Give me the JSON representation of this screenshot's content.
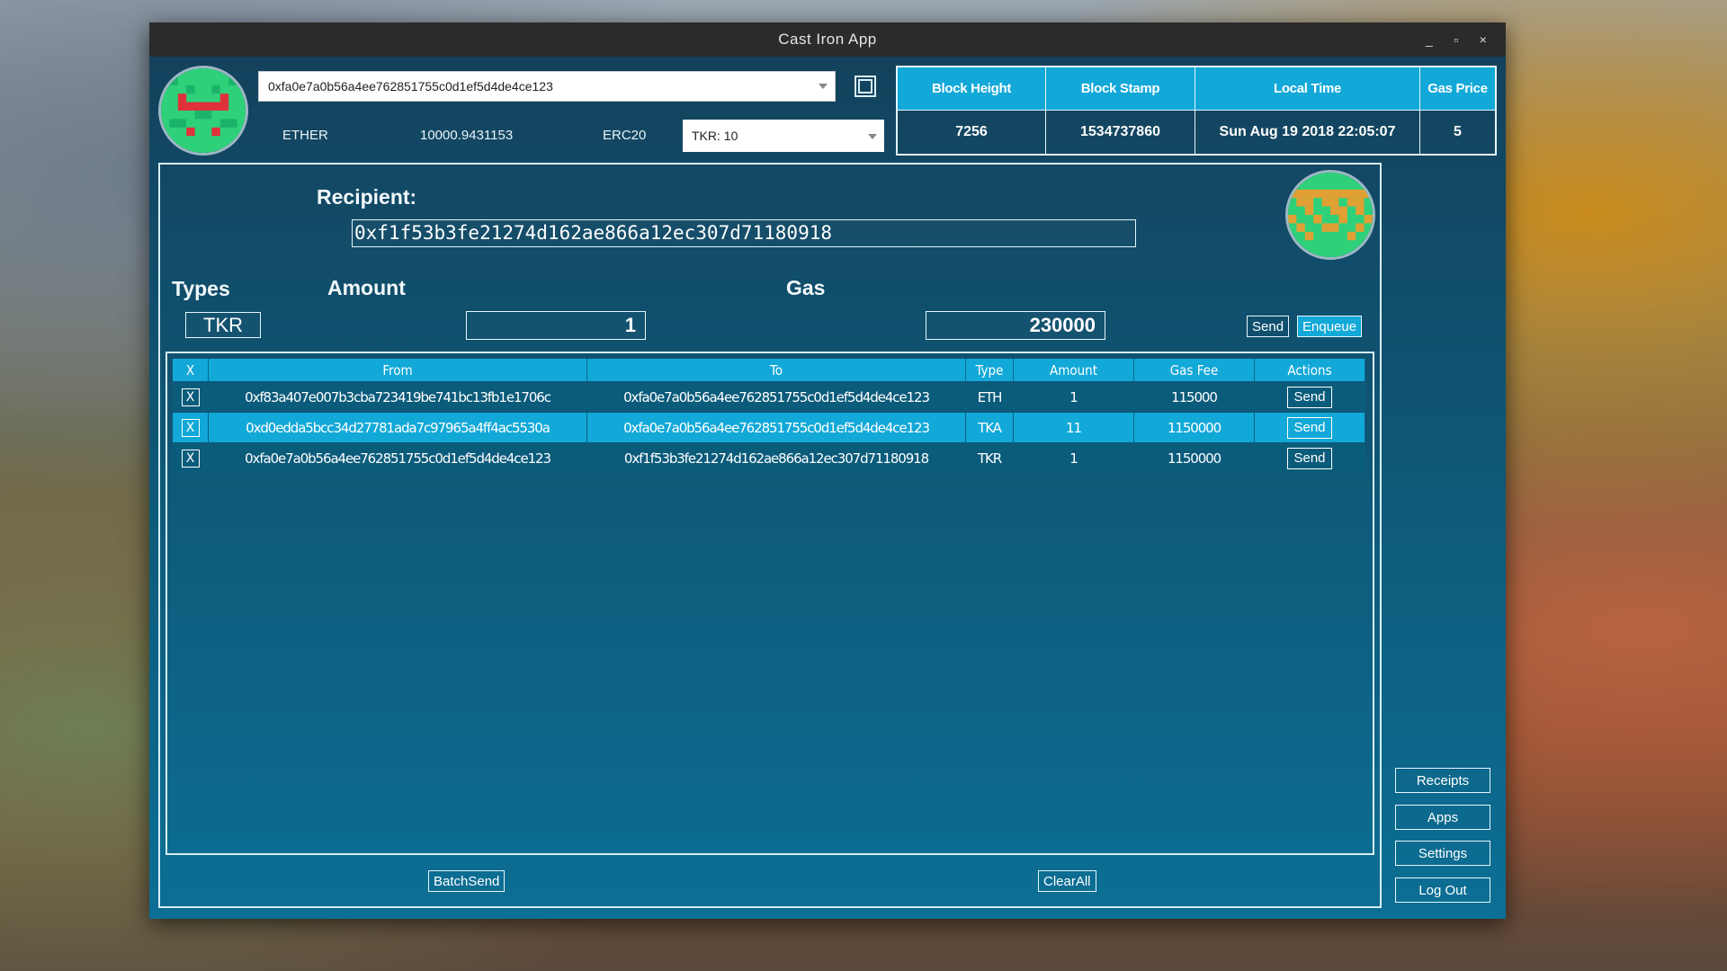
{
  "window": {
    "title": "Cast Iron App",
    "controls": [
      "_",
      "▫",
      "×"
    ]
  },
  "header": {
    "account_address": "0xfa0e7a0b56a4ee762851755c0d1ef5d4de4ce123",
    "ether_label": "ETHER",
    "ether_balance": "10000.9431153",
    "erc20_label": "ERC20",
    "token_select": "TKR: 10",
    "status": {
      "headers": [
        "Block Height",
        "Block Stamp",
        "Local Time",
        "Gas Price"
      ],
      "values": [
        "7256",
        "1534737860",
        "Sun Aug 19 2018 22:05:07",
        "5"
      ]
    }
  },
  "form": {
    "recipient_label": "Recipient:",
    "recipient_value": "0xf1f53b3fe21274d162ae866a12ec307d71180918",
    "types_label": "Types",
    "type_value": "TKR",
    "amount_label": "Amount",
    "amount_value": "1",
    "gas_label": "Gas",
    "gas_value": "230000",
    "send_label": "Send",
    "enqueue_label": "Enqueue"
  },
  "queue": {
    "columns": [
      "X",
      "From",
      "To",
      "Type",
      "Amount",
      "Gas Fee",
      "Actions"
    ],
    "rows": [
      {
        "x": "X",
        "from": "0xf83a407e007b3cba723419be741bc13fb1e1706c",
        "to": "0xfa0e7a0b56a4ee762851755c0d1ef5d4de4ce123",
        "type": "ETH",
        "amount": "1",
        "gas_fee": "115000",
        "action": "Send"
      },
      {
        "x": "X",
        "from": "0xd0edda5bcc34d27781ada7c97965a4ff4ac5530a",
        "to": "0xfa0e7a0b56a4ee762851755c0d1ef5d4de4ce123",
        "type": "TKA",
        "amount": "11",
        "gas_fee": "1150000",
        "action": "Send"
      },
      {
        "x": "X",
        "from": "0xfa0e7a0b56a4ee762851755c0d1ef5d4de4ce123",
        "to": "0xf1f53b3fe21274d162ae866a12ec307d71180918",
        "type": "TKR",
        "amount": "1",
        "gas_fee": "1150000",
        "action": "Send"
      }
    ],
    "batch_send_label": "BatchSend",
    "clear_all_label": "ClearAll"
  },
  "side_nav": {
    "receipts": "Receipts",
    "apps": "Apps",
    "settings": "Settings",
    "logout": "Log Out"
  },
  "colors": {
    "accent": "#12a8d8",
    "panel_dark": "#0b5b7b",
    "titlebar": "#2b2b2b"
  }
}
